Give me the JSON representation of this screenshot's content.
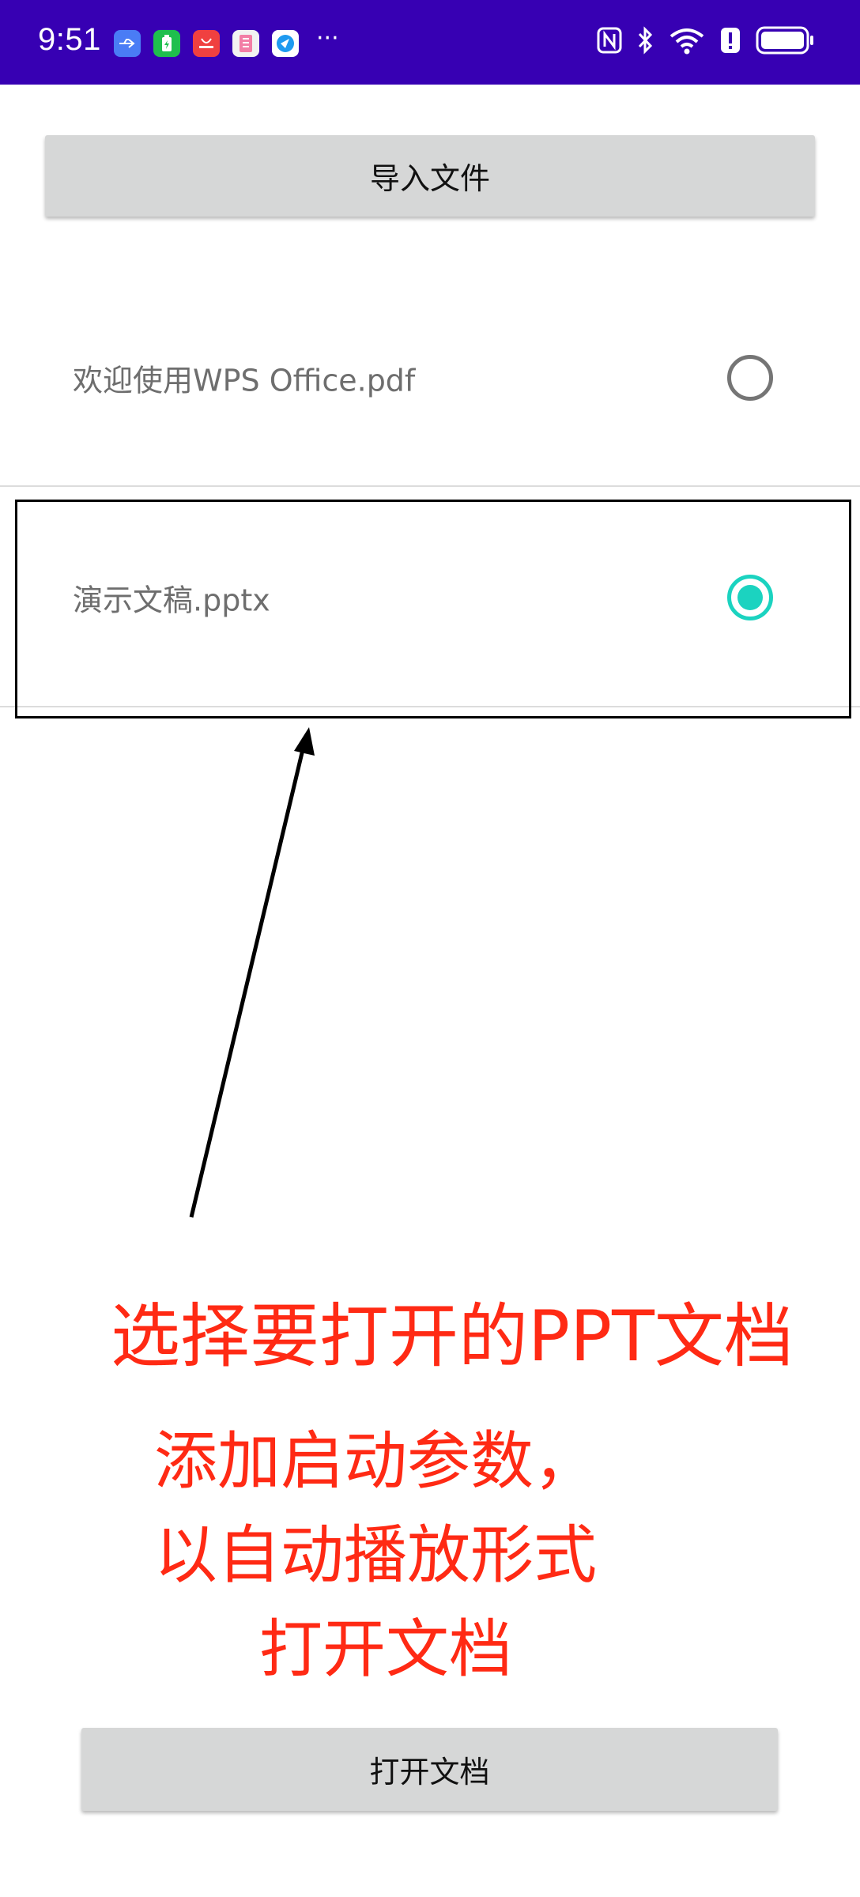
{
  "status_bar": {
    "time": "9:51",
    "more_indicator": "···",
    "background_color": "#3700b3",
    "notification_icons": [
      "usb-icon",
      "battery-app-icon",
      "huawei-app-icon",
      "book-app-icon",
      "browser-app-icon"
    ],
    "system_icons": [
      "nfc-icon",
      "bluetooth-icon",
      "wifi-icon",
      "alert-icon",
      "battery-icon"
    ]
  },
  "toolbar": {
    "import_label": "导入文件",
    "open_label": "打开文档"
  },
  "files": [
    {
      "name": "欢迎使用WPS Office.pdf",
      "selected": false
    },
    {
      "name": "演示文稿.pptx",
      "selected": true
    }
  ],
  "annotations": {
    "line1": "选择要打开的PPT文档",
    "line2": "添加启动参数，",
    "line3": "以自动播放形式",
    "line4": "打开文档"
  },
  "colors": {
    "accent": "#1bd3c0",
    "annotation": "#ff2a14",
    "button": "#d6d7d7"
  }
}
